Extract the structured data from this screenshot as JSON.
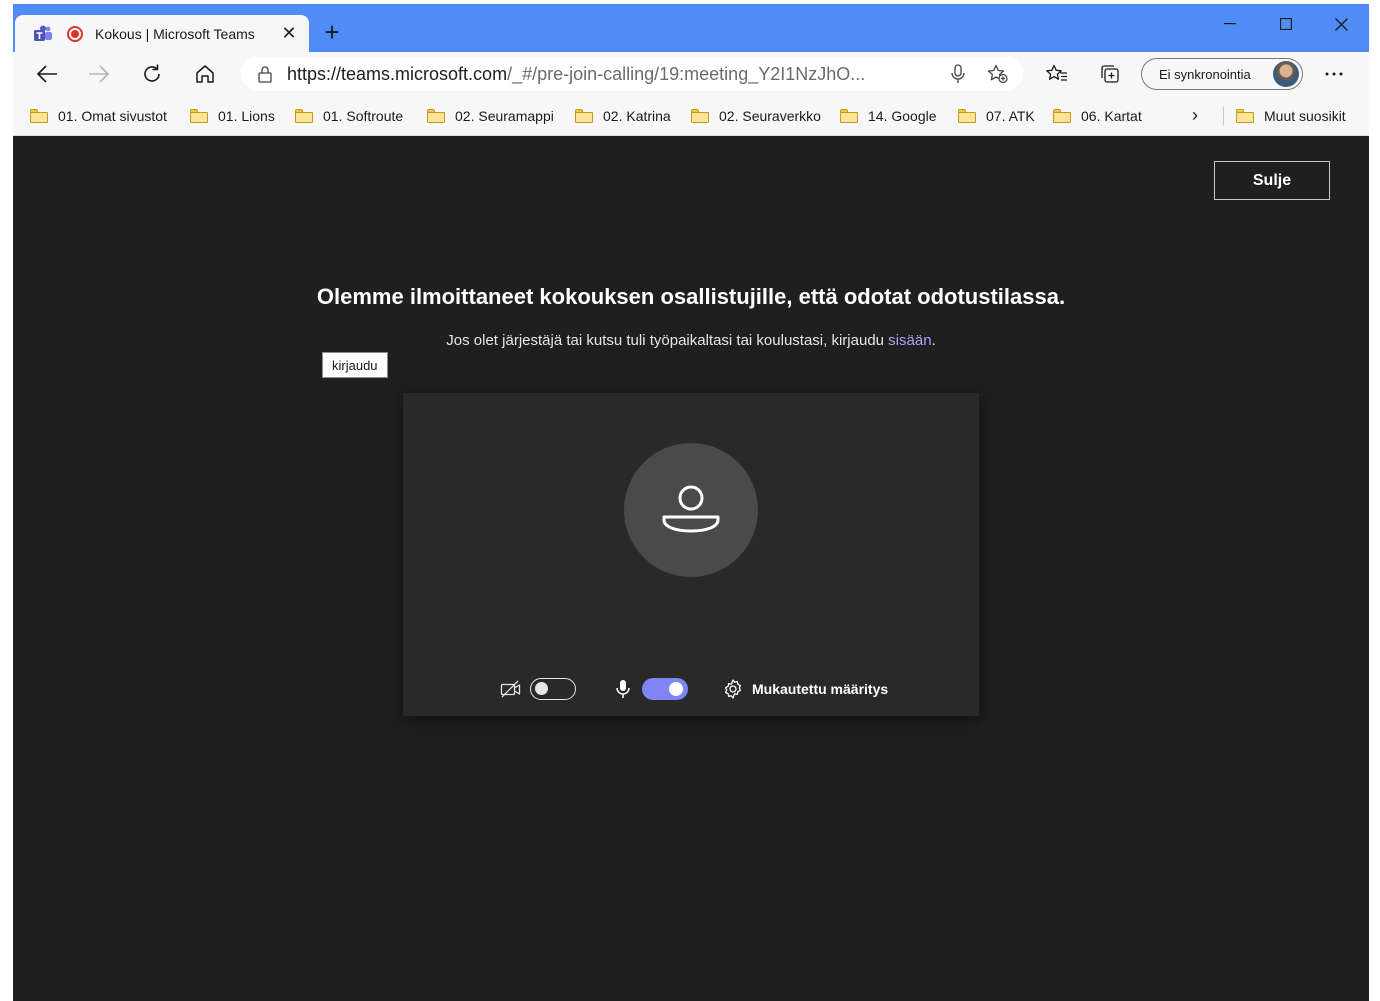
{
  "browser": {
    "tab_title": "Kokous | Microsoft Teams",
    "url_host": "https://teams.microsoft.com",
    "url_path": "/_#/pre-join-calling/19:meeting_Y2I1NzJhO...",
    "profile_label": "Ei synkronointia",
    "bookmarks": [
      {
        "label": "01. Omat sivustot"
      },
      {
        "label": "01. Lions"
      },
      {
        "label": "01. Softroute"
      },
      {
        "label": "02. Seuramappi"
      },
      {
        "label": "02. Katrina"
      },
      {
        "label": "02. Seuraverkko"
      },
      {
        "label": "14. Google"
      },
      {
        "label": "07. ATK"
      },
      {
        "label": "06. Kartat"
      }
    ],
    "other_bookmarks": "Muut suosikit"
  },
  "page": {
    "close_label": "Sulje",
    "headline": "Olemme ilmoittaneet kokouksen osallistujille, että odotat odotustilassa.",
    "subline_prefix": "Jos olet järjestäjä tai kutsu tuli työpaikaltasi tai koulustasi, kirjaudu ",
    "subline_link": "sisään",
    "subline_suffix": ".",
    "tooltip": "kirjaudu",
    "controls": {
      "camera_on": false,
      "mic_on": true,
      "settings_label": "Mukautettu määritys"
    }
  },
  "colors": {
    "titlebar": "#4f8cf5",
    "background": "#1f1f1f",
    "accent": "#7f85f5",
    "link": "#a9a3f3"
  }
}
